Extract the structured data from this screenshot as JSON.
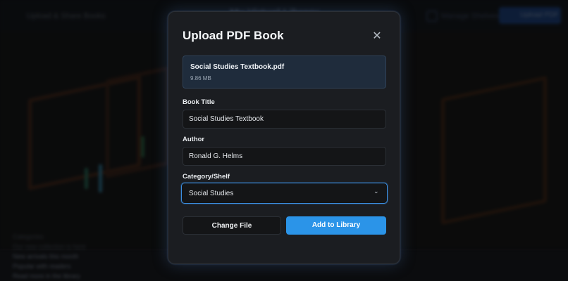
{
  "background": {
    "brand_text": "Upload & Share Books",
    "center_title": "My Virtual Library",
    "nav_label": "Manage Shelves",
    "action_button": "Upload PDF",
    "list_items": [
      "Categories",
      "Our new collection is here",
      "New arrivals this month",
      "Popular with readers",
      "Read more in the library"
    ]
  },
  "modal": {
    "title": "Upload PDF Book",
    "close_icon": "close-icon",
    "file": {
      "name": "Social Studies Textbook.pdf",
      "size": "9.86 MB"
    },
    "fields": {
      "title_label": "Book Title",
      "title_value": "Social Studies Textbook",
      "author_label": "Author",
      "author_value": "Ronald G. Helms",
      "category_label": "Category/Shelf",
      "category_value": "Social Studies"
    },
    "buttons": {
      "secondary": "Change File",
      "primary": "Add to Library"
    }
  },
  "colors": {
    "accent": "#2b94e8",
    "focus_border": "#3b8ee0",
    "modal_bg": "#1b1d21",
    "file_card_bg": "#1f2c3c"
  }
}
